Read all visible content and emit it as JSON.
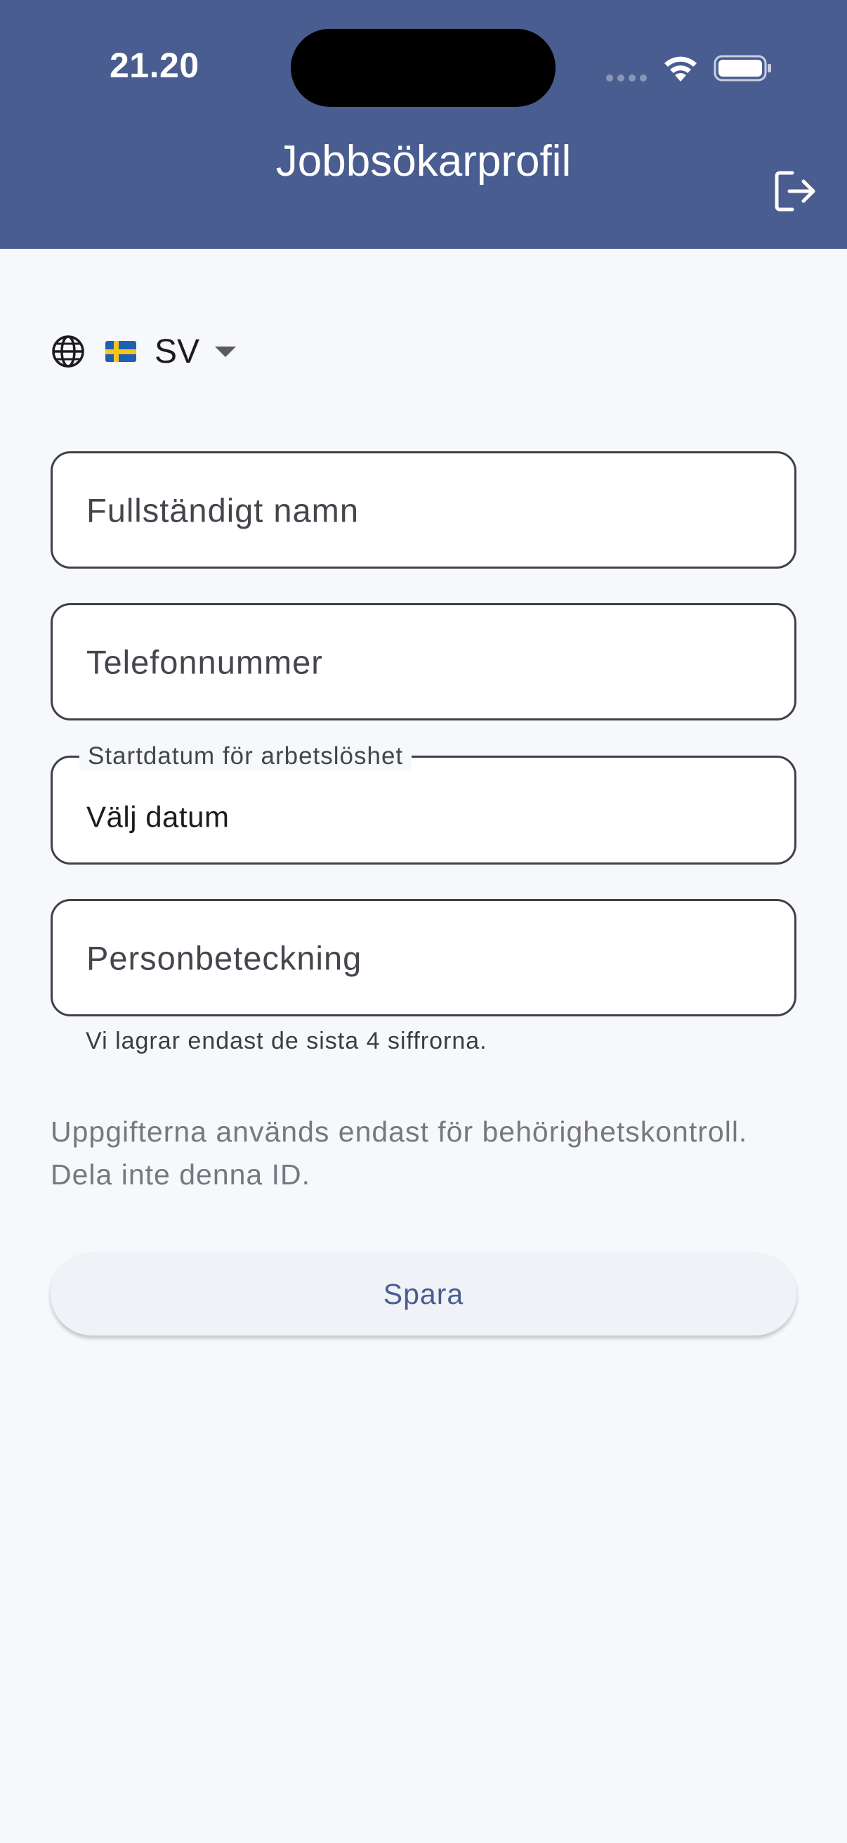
{
  "status_bar": {
    "time": "21.20"
  },
  "header": {
    "title": "Jobbsökarprofil",
    "logout_icon": "logout-icon",
    "background_color": "#4a5d91"
  },
  "language": {
    "icon": "globe-icon",
    "flag": "sweden-flag",
    "code": "SV"
  },
  "form": {
    "full_name": {
      "placeholder": "Fullständigt namn"
    },
    "phone": {
      "placeholder": "Telefonnummer"
    },
    "start_date": {
      "label": "Startdatum för arbetslöshet",
      "value": "Välj datum"
    },
    "personal_id": {
      "placeholder": "Personbeteckning",
      "helper": "Vi lagrar endast de sista 4 siffrorna."
    },
    "info": "Uppgifterna används endast för behörighetskontroll. Dela inte denna ID.",
    "save_label": "Spara"
  }
}
